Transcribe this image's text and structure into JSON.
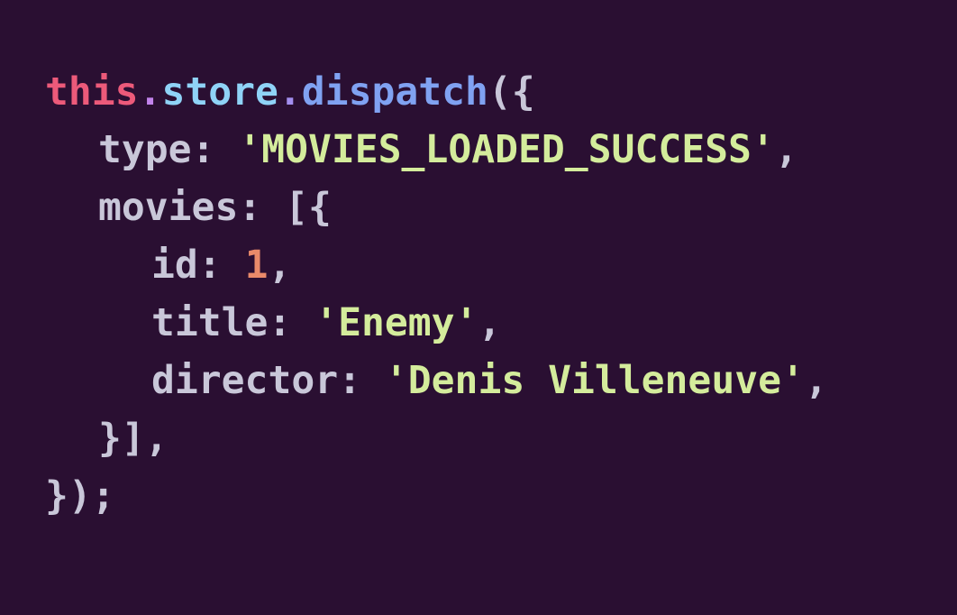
{
  "code": {
    "line1": {
      "this": "this",
      "dot1": ".",
      "store": "store",
      "dot2": ".",
      "dispatch": "dispatch",
      "open": "({"
    },
    "line2": {
      "key": "type",
      "colon": ": ",
      "value": "'MOVIES_LOADED_SUCCESS'",
      "comma": ","
    },
    "line3": {
      "key": "movies",
      "colon": ": ",
      "open": "[{"
    },
    "line4": {
      "key": "id",
      "colon": ": ",
      "value": "1",
      "comma": ","
    },
    "line5": {
      "key": "title",
      "colon": ": ",
      "value": "'Enemy'",
      "comma": ","
    },
    "line6": {
      "key": "director",
      "colon": ": ",
      "value": "'Denis Villeneuve'",
      "comma": ","
    },
    "line7": {
      "close": "}],"
    },
    "line8": {
      "close": "});"
    }
  },
  "colors": {
    "background": "#2a0f32",
    "this": "#ec5a7a",
    "store": "#8fd3f7",
    "dispatch": "#80a2f2",
    "string": "#d4ec9c",
    "number": "#e98a6a",
    "text": "#c9c7d9"
  }
}
